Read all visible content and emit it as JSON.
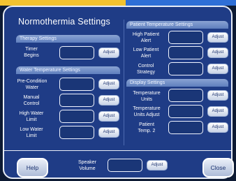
{
  "app": {
    "title": "Normothermia Settings"
  },
  "sections": {
    "therapy": "Therapy Settings",
    "water": "Water Temperature Settings",
    "patient": "Patient Temperature Settings",
    "display": "Display Settings"
  },
  "therapy": {
    "timer_begins": "Timer\nBegins"
  },
  "water": {
    "pre_condition": "Pre-Condition\nWater",
    "manual_control": "Manual\nControl",
    "high_water_limit": "High Water\nLimit",
    "low_water_limit": "Low Water\nLimit"
  },
  "patient": {
    "high_alert": "High Patient\nAlert",
    "low_alert": "Low Patient\nAlert",
    "control_strategy": "Control\nStrategy"
  },
  "display": {
    "temp_units": "Temperature\nUnits",
    "temp_units_adjust": "Temperature\nUnits Adjust",
    "patient_temp2": "Patient\nTemp. 2"
  },
  "buttons": {
    "adjust": "Adjust",
    "help": "Help",
    "close": "Close"
  },
  "speaker": {
    "label": "Speaker\nVolume"
  },
  "colors": {
    "background": "#1f3c86",
    "section_header": "#7a96c9",
    "top_left_strip": "#f2c230",
    "top_right_strip": "#2f6fd6"
  }
}
